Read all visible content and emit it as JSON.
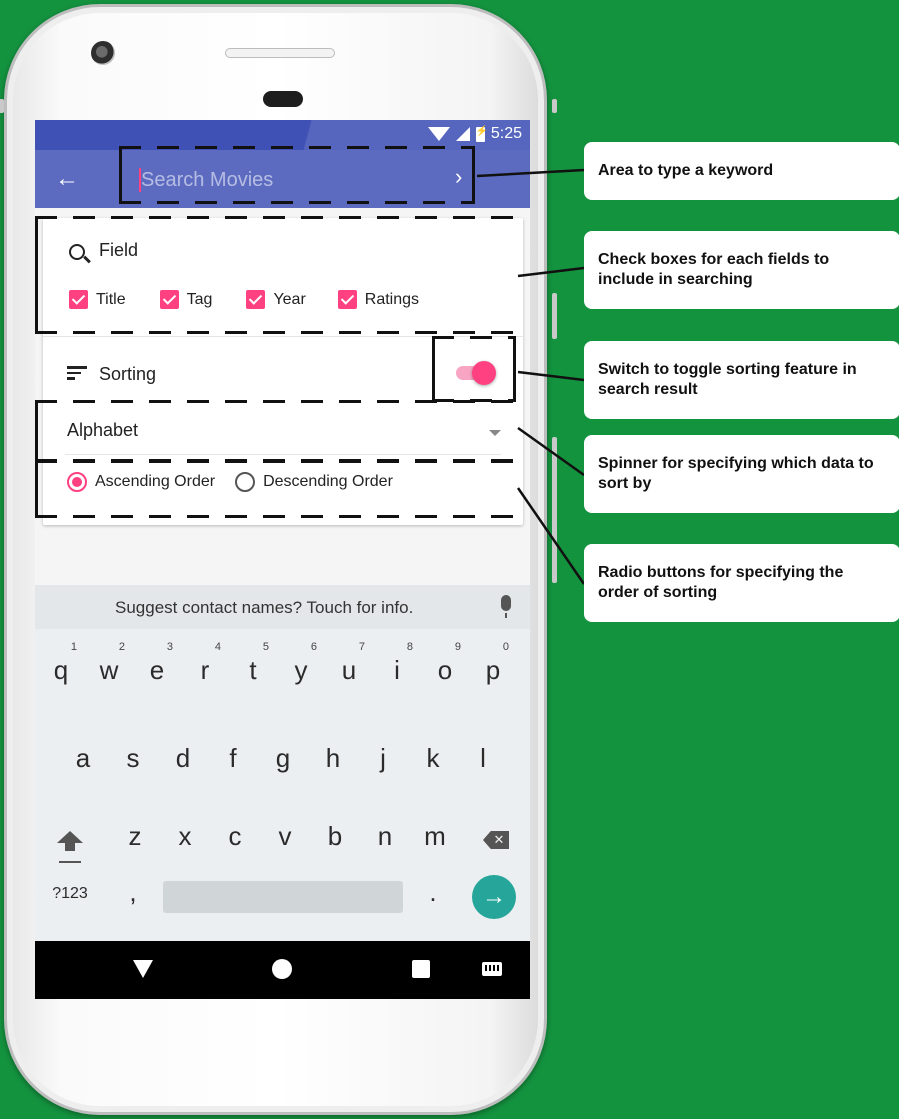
{
  "status_bar": {
    "time": "5:25"
  },
  "app_bar": {
    "search_placeholder": "Search Movies"
  },
  "field_section": {
    "title": "Field",
    "checkboxes": [
      {
        "label": "Title",
        "checked": true
      },
      {
        "label": "Tag",
        "checked": true
      },
      {
        "label": "Year",
        "checked": true
      },
      {
        "label": "Ratings",
        "checked": true
      }
    ]
  },
  "sorting_section": {
    "title": "Sorting",
    "switch_on": true,
    "spinner_value": "Alphabet",
    "radios": [
      {
        "label": "Ascending Order",
        "selected": true
      },
      {
        "label": "Descending Order",
        "selected": false
      }
    ]
  },
  "keyboard": {
    "suggestion": "Suggest contact names? Touch for info.",
    "row1": [
      "q",
      "w",
      "e",
      "r",
      "t",
      "y",
      "u",
      "i",
      "o",
      "p"
    ],
    "row1_hints": [
      "1",
      "2",
      "3",
      "4",
      "5",
      "6",
      "7",
      "8",
      "9",
      "0"
    ],
    "row2": [
      "a",
      "s",
      "d",
      "f",
      "g",
      "h",
      "j",
      "k",
      "l"
    ],
    "row3": [
      "z",
      "x",
      "c",
      "v",
      "b",
      "n",
      "m"
    ],
    "symbols_key": "?123",
    "comma_key": ",",
    "period_key": "."
  },
  "callouts": [
    "Area to type a keyword",
    "Check boxes for each fields to include in searching",
    "Switch to toggle sorting feature in search result",
    "Spinner for specifying which data to sort by",
    "Radio buttons for specifying the order of sorting"
  ],
  "colors": {
    "background": "#14933f",
    "status_bar": "#3f51b5",
    "app_bar": "#5c6bc0",
    "accent": "#ff4081",
    "enter_key": "#26a69a"
  }
}
